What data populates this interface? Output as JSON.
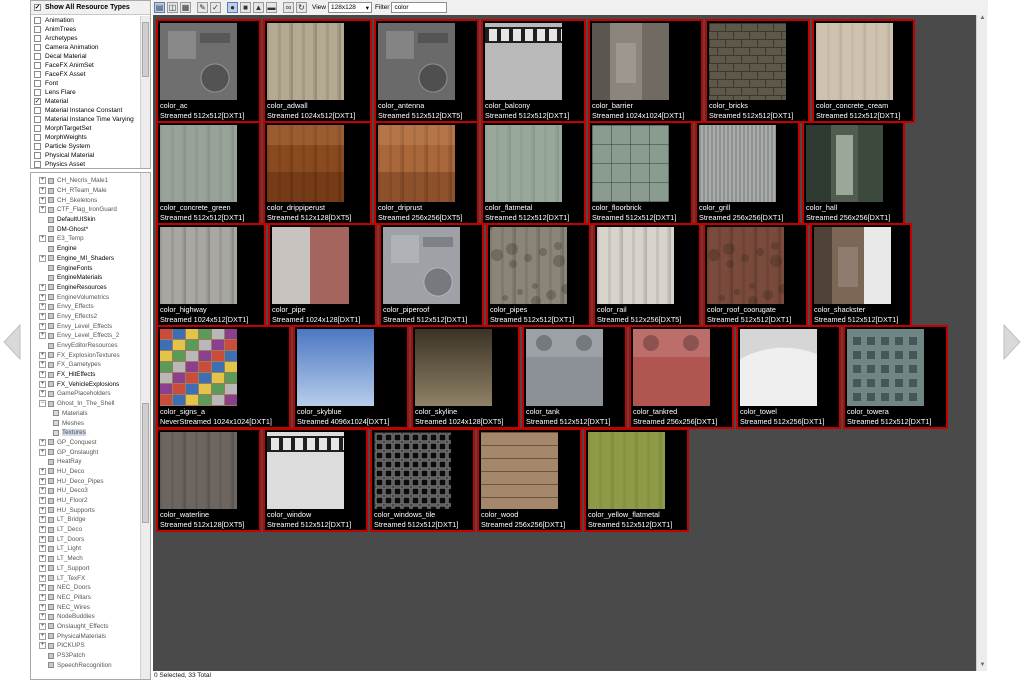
{
  "types_panel": {
    "show_all_label": "Show All Resource Types",
    "show_all_checked": true,
    "items": [
      {
        "label": "Animation",
        "checked": false
      },
      {
        "label": "AnimTrees",
        "checked": false
      },
      {
        "label": "Archetypes",
        "checked": false
      },
      {
        "label": "Camera Animation",
        "checked": false
      },
      {
        "label": "Decal Material",
        "checked": false
      },
      {
        "label": "FaceFX AnimSet",
        "checked": false
      },
      {
        "label": "FaceFX Asset",
        "checked": false
      },
      {
        "label": "Font",
        "checked": false
      },
      {
        "label": "Lens Flare",
        "checked": false
      },
      {
        "label": "Material",
        "checked": true
      },
      {
        "label": "Material Instance Constant",
        "checked": false
      },
      {
        "label": "Material Instance Time Varying",
        "checked": false
      },
      {
        "label": "MorphTargetSet",
        "checked": false
      },
      {
        "label": "MorphWeights",
        "checked": false
      },
      {
        "label": "Particle System",
        "checked": false
      },
      {
        "label": "Physical Material",
        "checked": false
      },
      {
        "label": "Physics Asset",
        "checked": false
      }
    ]
  },
  "tree": [
    {
      "label": "CH_Necris_Male1",
      "expandable": true,
      "bold": false
    },
    {
      "label": "CH_RTeam_Male",
      "expandable": true,
      "bold": false
    },
    {
      "label": "CH_Skeletons",
      "expandable": true,
      "bold": false
    },
    {
      "label": "CTF_Flag_IronGuard",
      "expandable": true,
      "bold": false
    },
    {
      "label": "DefaultUISkin",
      "expandable": false,
      "bold": true
    },
    {
      "label": "DM-Ghost*",
      "expandable": false,
      "bold": true
    },
    {
      "label": "E3_Temp",
      "expandable": true,
      "bold": false
    },
    {
      "label": "Engine",
      "expandable": false,
      "bold": true
    },
    {
      "label": "Engine_MI_Shaders",
      "expandable": true,
      "bold": true
    },
    {
      "label": "EngineFonts",
      "expandable": false,
      "bold": true
    },
    {
      "label": "EngineMaterials",
      "expandable": false,
      "bold": true
    },
    {
      "label": "EngineResources",
      "expandable": true,
      "bold": true
    },
    {
      "label": "EngineVolumetrics",
      "expandable": true,
      "bold": false
    },
    {
      "label": "Envy_Effects",
      "expandable": true,
      "bold": false
    },
    {
      "label": "Envy_Effects2",
      "expandable": true,
      "bold": false
    },
    {
      "label": "Envy_Level_Effects",
      "expandable": true,
      "bold": false
    },
    {
      "label": "Envy_Level_Effects_2",
      "expandable": true,
      "bold": false
    },
    {
      "label": "EnvyEditorResources",
      "expandable": false,
      "bold": false
    },
    {
      "label": "FX_ExplosionTextures",
      "expandable": true,
      "bold": false
    },
    {
      "label": "FX_Gametypes",
      "expandable": true,
      "bold": false
    },
    {
      "label": "FX_HitEffects",
      "expandable": true,
      "bold": true
    },
    {
      "label": "FX_VehicleExplosions",
      "expandable": true,
      "bold": true
    },
    {
      "label": "GamePlaceholders",
      "expandable": true,
      "bold": false
    },
    {
      "label": "Ghost_In_The_Shell",
      "expandable": true,
      "bold": false,
      "expanded": true
    },
    {
      "label": "Materials",
      "child": true,
      "bold": false
    },
    {
      "label": "Meshes",
      "child": true,
      "bold": false
    },
    {
      "label": "Textures",
      "child": true,
      "bold": false,
      "selected": true
    },
    {
      "label": "GP_Conquest",
      "expandable": true,
      "bold": false
    },
    {
      "label": "GP_Onslaught",
      "expandable": true,
      "bold": false
    },
    {
      "label": "HeatRay",
      "expandable": false,
      "bold": false
    },
    {
      "label": "HU_Deco",
      "expandable": true,
      "bold": false
    },
    {
      "label": "HU_Deco_Pipes",
      "expandable": true,
      "bold": false
    },
    {
      "label": "HU_Deco3",
      "expandable": true,
      "bold": false
    },
    {
      "label": "HU_Floor2",
      "expandable": true,
      "bold": false
    },
    {
      "label": "HU_Supports",
      "expandable": true,
      "bold": false
    },
    {
      "label": "LT_Bridge",
      "expandable": true,
      "bold": false
    },
    {
      "label": "LT_Deco",
      "expandable": true,
      "bold": false
    },
    {
      "label": "LT_Doors",
      "expandable": true,
      "bold": false
    },
    {
      "label": "LT_Light",
      "expandable": true,
      "bold": false
    },
    {
      "label": "LT_Mech",
      "expandable": true,
      "bold": false
    },
    {
      "label": "LT_Support",
      "expandable": true,
      "bold": false
    },
    {
      "label": "LT_TexFX",
      "expandable": true,
      "bold": false
    },
    {
      "label": "NEC_Doors",
      "expandable": true,
      "bold": false
    },
    {
      "label": "NEC_Pillars",
      "expandable": true,
      "bold": false
    },
    {
      "label": "NEC_Wires",
      "expandable": true,
      "bold": false
    },
    {
      "label": "NodeBuddies",
      "expandable": true,
      "bold": false
    },
    {
      "label": "Onslaught_Effects",
      "expandable": true,
      "bold": false
    },
    {
      "label": "PhysicalMaterials",
      "expandable": true,
      "bold": false
    },
    {
      "label": "PICKUPS",
      "expandable": true,
      "bold": false
    },
    {
      "label": "PS3Patch",
      "expandable": false,
      "bold": false
    },
    {
      "label": "SpeechRecognition",
      "expandable": false,
      "bold": false
    }
  ],
  "toolbar": {
    "view_label": "View",
    "view_value": "128x128",
    "filter_label": "Filter",
    "filter_value": "color"
  },
  "tiles": [
    {
      "name": "color_ac",
      "info": "Streamed 512x512[DXT1]",
      "color": "#6f6f6f",
      "pattern": "ac"
    },
    {
      "name": "color_adwall",
      "info": "Streamed 1024x512[DXT1]",
      "color": "#b4a991",
      "pattern": "streak"
    },
    {
      "name": "color_antenna",
      "info": "Streamed 512x512[DXT5]",
      "color": "#6a6a6a",
      "pattern": "antenna"
    },
    {
      "name": "color_balcony",
      "info": "Streamed 512x512[DXT1]",
      "color": "#b9b9b9",
      "pattern": "balcony"
    },
    {
      "name": "color_barrier",
      "info": "Streamed 1024x1024[DXT1]",
      "color": "#8c857b",
      "pattern": "barrier"
    },
    {
      "name": "color_bricks",
      "info": "Streamed 512x512[DXT1]",
      "color": "#5e5848",
      "pattern": "bricks"
    },
    {
      "name": "color_concrete_cream",
      "info": "Streamed 512x512[DXT1]",
      "color": "#cfc3b0",
      "pattern": "flat"
    },
    {
      "name": "color_concrete_green",
      "info": "Streamed 512x512[DXT1]",
      "color": "#97a298",
      "pattern": "flat"
    },
    {
      "name": "color_drippiperust",
      "info": "Streamed 512x128[DXT5]",
      "color": "#8a4a1f",
      "pattern": "rust"
    },
    {
      "name": "color_driprust",
      "info": "Streamed 256x256[DXT5]",
      "color": "#a9673a",
      "pattern": "rust"
    },
    {
      "name": "color_flatmetal",
      "info": "Streamed 512x512[DXT1]",
      "color": "#98a89b",
      "pattern": "flat"
    },
    {
      "name": "color_floorbrick",
      "info": "Streamed 512x512[DXT1]",
      "color": "#8a9c90",
      "pattern": "tiles"
    },
    {
      "name": "color_grill",
      "info": "Streamed 256x256[DXT1]",
      "color": "#a7acaa",
      "pattern": "grill"
    },
    {
      "name": "color_hall",
      "info": "Streamed 256x256[DXT1]",
      "color": "#4f5c4e",
      "pattern": "hall"
    },
    {
      "name": "color_highway",
      "info": "Streamed 1024x512[DXT1]",
      "color": "#a8a7a2",
      "pattern": "streak"
    },
    {
      "name": "color_pipe",
      "info": "Streamed 1024x128[DXT1]",
      "color": "#c9c3bf",
      "pattern": "pipe"
    },
    {
      "name": "color_piperoof",
      "info": "Streamed 512x512[DXT1]",
      "color": "#9ea2a7",
      "pattern": "piperoof"
    },
    {
      "name": "color_pipes",
      "info": "Streamed 512x512[DXT1]",
      "color": "#8a8578",
      "pattern": "grime"
    },
    {
      "name": "color_rail",
      "info": "Streamed 512x256[DXT5]",
      "color": "#d8d4cc",
      "pattern": "streak"
    },
    {
      "name": "color_roof_coorugate",
      "info": "Streamed 512x512[DXT1]",
      "color": "#7a4a3c",
      "pattern": "grime"
    },
    {
      "name": "color_shackster",
      "info": "Streamed 512x512[DXT1]",
      "color": "#7c6656",
      "pattern": "shack"
    },
    {
      "name": "color_signs_a",
      "info": "NeverStreamed 1024x1024[DXT1]",
      "color": "#9d7b5c",
      "pattern": "signs"
    },
    {
      "name": "color_skyblue",
      "info": "Streamed 4096x1024[DXT1]",
      "color": "#7ea0d6",
      "pattern": "sky"
    },
    {
      "name": "color_skyline",
      "info": "Streamed 1024x128[DXT5]",
      "color": "#5d5340",
      "pattern": "skyline"
    },
    {
      "name": "color_tank",
      "info": "Streamed 512x512[DXT1]",
      "color": "#8b9197",
      "pattern": "tank"
    },
    {
      "name": "color_tankred",
      "info": "Streamed 256x256[DXT1]",
      "color": "#b05550",
      "pattern": "tankred"
    },
    {
      "name": "color_towel",
      "info": "Streamed 512x256[DXT1]",
      "color": "#d6d6d6",
      "pattern": "towel"
    },
    {
      "name": "color_towera",
      "info": "Streamed 512x512[DXT1]",
      "color": "#6f8684",
      "pattern": "towera"
    },
    {
      "name": "color_waterline",
      "info": "Streamed 512x128[DXT5]",
      "color": "#6d6660",
      "pattern": "streak"
    },
    {
      "name": "color_window",
      "info": "Streamed 512x512[DXT1]",
      "color": "#dcdcdc",
      "pattern": "window"
    },
    {
      "name": "color_windows_tile",
      "info": "Streamed 512x512[DXT1]",
      "color": "#2a2a2a",
      "pattern": "wintile"
    },
    {
      "name": "color_wood",
      "info": "Streamed 256x256[DXT1]",
      "color": "#a4876a",
      "pattern": "wood"
    },
    {
      "name": "color_yellow_flatmetal",
      "info": "Streamed 512x512[DXT1]",
      "color": "#8e9a45",
      "pattern": "flat"
    }
  ],
  "status": {
    "text": "0 Selected, 33 Total"
  },
  "colors": {
    "selection_border": "#c40000",
    "grid_background": "#4a4a4a"
  }
}
